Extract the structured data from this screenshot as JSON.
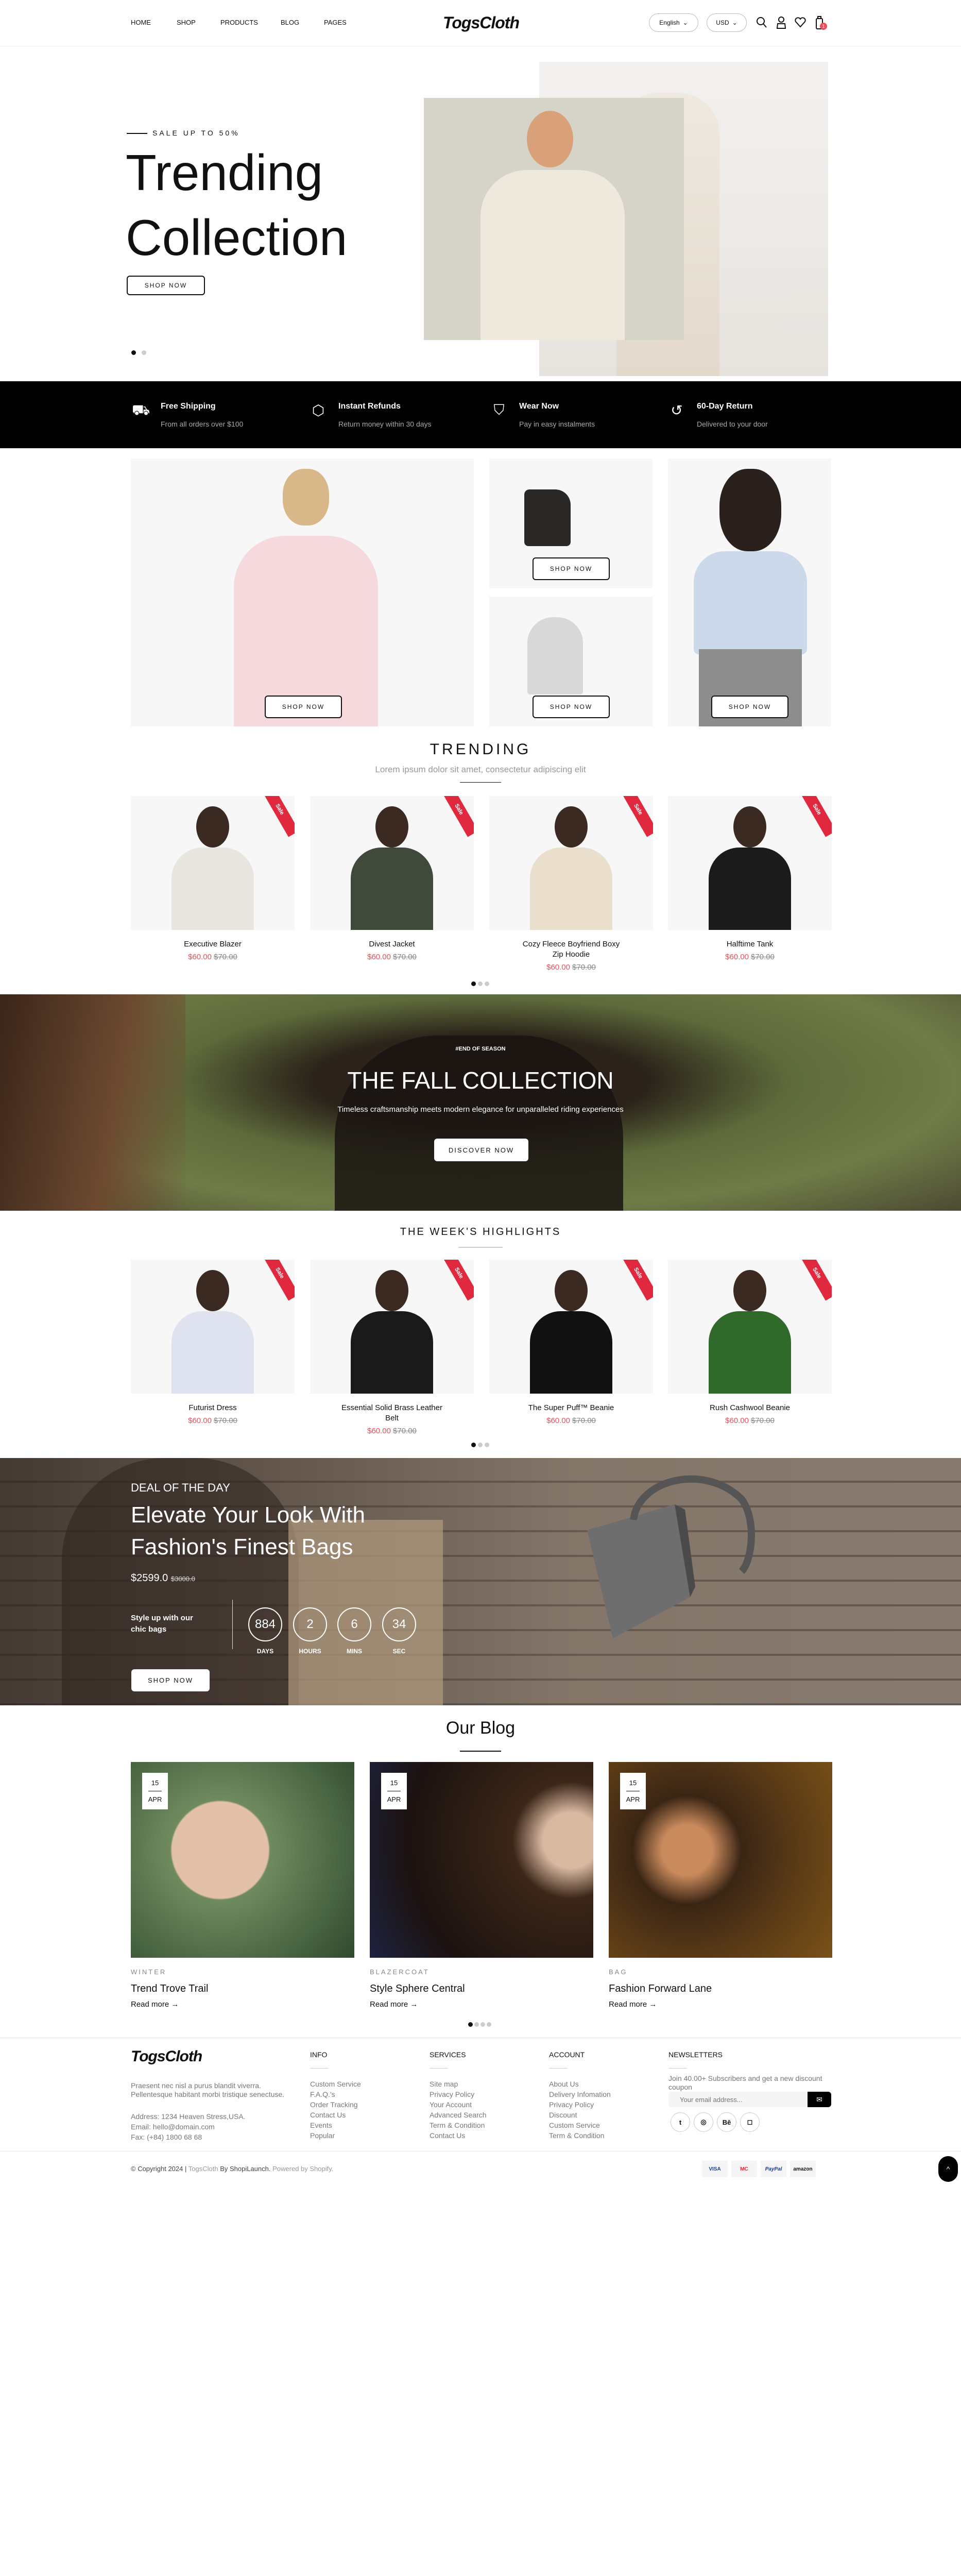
{
  "header": {
    "nav": [
      "HOME",
      "SHOP",
      "PRODUCTS",
      "BLOG",
      "PAGES"
    ],
    "logo": "TogsCloth",
    "language": "English",
    "currency": "USD",
    "cart_count": "1"
  },
  "hero": {
    "eyebrow": "SALE UP TO 50%",
    "title_line1": "Trending",
    "title_line2": "Collection",
    "button": "SHOP NOW",
    "slide_index": 1,
    "slide_count": 2
  },
  "features": [
    {
      "icon": "truck-icon",
      "title": "Free Shipping",
      "sub": "From all orders over $100"
    },
    {
      "icon": "box-icon",
      "title": "Instant Refunds",
      "sub": "Return money within 30 days"
    },
    {
      "icon": "shield-check-icon",
      "title": "Wear Now",
      "sub": "Pay in easy instalments"
    },
    {
      "icon": "return-icon",
      "title": "60-Day Return",
      "sub": "Delivered to your door"
    }
  ],
  "banners": {
    "button": "SHOP NOW"
  },
  "trending": {
    "title": "TRENDING",
    "subtitle": "Lorem ipsum dolor sit amet, consectetur adipiscing elit",
    "badge": "Sale",
    "products": [
      {
        "name": "Executive Blazer",
        "price": "$60.00",
        "old": "$70.00",
        "color": "#e9e5df"
      },
      {
        "name": "Divest Jacket",
        "price": "$60.00",
        "old": "$70.00",
        "color": "#3f4a3a"
      },
      {
        "name": "Cozy Fleece Boyfriend Boxy Zip Hoodie",
        "price": "$60.00",
        "old": "$70.00",
        "color": "#eadfcd"
      },
      {
        "name": "Halftime Tank",
        "price": "$60.00",
        "old": "$70.00",
        "color": "#1b1b1b"
      }
    ]
  },
  "fall": {
    "eyebrow": "#END OF SEASON",
    "title": "THE FALL COLLECTION",
    "desc": "Timeless craftsmanship meets modern elegance for unparalleled riding experiences",
    "button": "DISCOVER NOW"
  },
  "highlights": {
    "title": "THE WEEK'S HIGHLIGHTS",
    "badge": "Sale",
    "products": [
      {
        "name": "Futurist Dress",
        "price": "$60.00",
        "old": "$70.00",
        "color": "#dfe3f0"
      },
      {
        "name": "Essential Solid Brass Leather Belt",
        "price": "$60.00",
        "old": "$70.00",
        "color": "#1a1a1a"
      },
      {
        "name": "The Super Puff™ Beanie",
        "price": "$60.00",
        "old": "$70.00",
        "color": "#111111"
      },
      {
        "name": "Rush Cashwool Beanie",
        "price": "$60.00",
        "old": "$70.00",
        "color": "#2f6a2a"
      }
    ]
  },
  "deal": {
    "eyebrow": "DEAL OF THE DAY",
    "title_line1": "Elevate Your Look With",
    "title_line2": "Fashion's Finest Bags",
    "price": "$2599.0",
    "old_price": "$3000.0",
    "tagline": "Style up with our chic bags",
    "countdown": [
      {
        "value": "884",
        "label": "DAYS"
      },
      {
        "value": "2",
        "label": "HOURS"
      },
      {
        "value": "6",
        "label": "MINS"
      },
      {
        "value": "34",
        "label": "SEC"
      }
    ],
    "button": "SHOP NOW"
  },
  "blog": {
    "title": "Our Blog",
    "read_more": "Read more →",
    "posts": [
      {
        "day": "15",
        "month": "APR",
        "category": "WINTER",
        "title": "Trend Trove Trail"
      },
      {
        "day": "15",
        "month": "APR",
        "category": "BLAZERCOAT",
        "title": "Style Sphere Central"
      },
      {
        "day": "15",
        "month": "APR",
        "category": "BAG",
        "title": "Fashion Forward Lane"
      }
    ]
  },
  "footer": {
    "logo": "TogsCloth",
    "about": "Praesent nec nisl a purus blandit viverra. Pellentesque habitant morbi tristique senectuse.",
    "address": "Address: 1234 Heaven Stress,USA.",
    "email": "Email: hello@domain.com",
    "fax": "Fax: (+84) 1800 68 68",
    "columns": [
      {
        "heading": "INFO",
        "links": [
          "Custom Service",
          "F.A.Q.'s",
          "Order Tracking",
          "Contact Us",
          "Events",
          "Popular"
        ]
      },
      {
        "heading": "SERVICES",
        "links": [
          "Site map",
          "Privacy Policy",
          "Your Account",
          "Advanced Search",
          "Term & Condition",
          "Contact Us"
        ]
      },
      {
        "heading": "ACCOUNT",
        "links": [
          "About Us",
          "Delivery Infomation",
          "Privacy Policy",
          "Discount",
          "Custom Service",
          "Term & Condition"
        ]
      }
    ],
    "newsletter": {
      "heading": "NEWSLETTERS",
      "text": "Join 40.00+ Subscribers and get a new discount coupon",
      "placeholder": "Your email address..."
    },
    "social": [
      "twitter-icon",
      "dribbble-icon",
      "behance-icon",
      "instagram-icon"
    ],
    "copyright": "© Copyright 2024 |",
    "brand_link": "TogsCloth",
    "by": "By ShopiLaunch.",
    "powered": "Powered by Shopify.",
    "payments": [
      "VISA",
      "MC",
      "PayPal",
      "amazon"
    ]
  }
}
